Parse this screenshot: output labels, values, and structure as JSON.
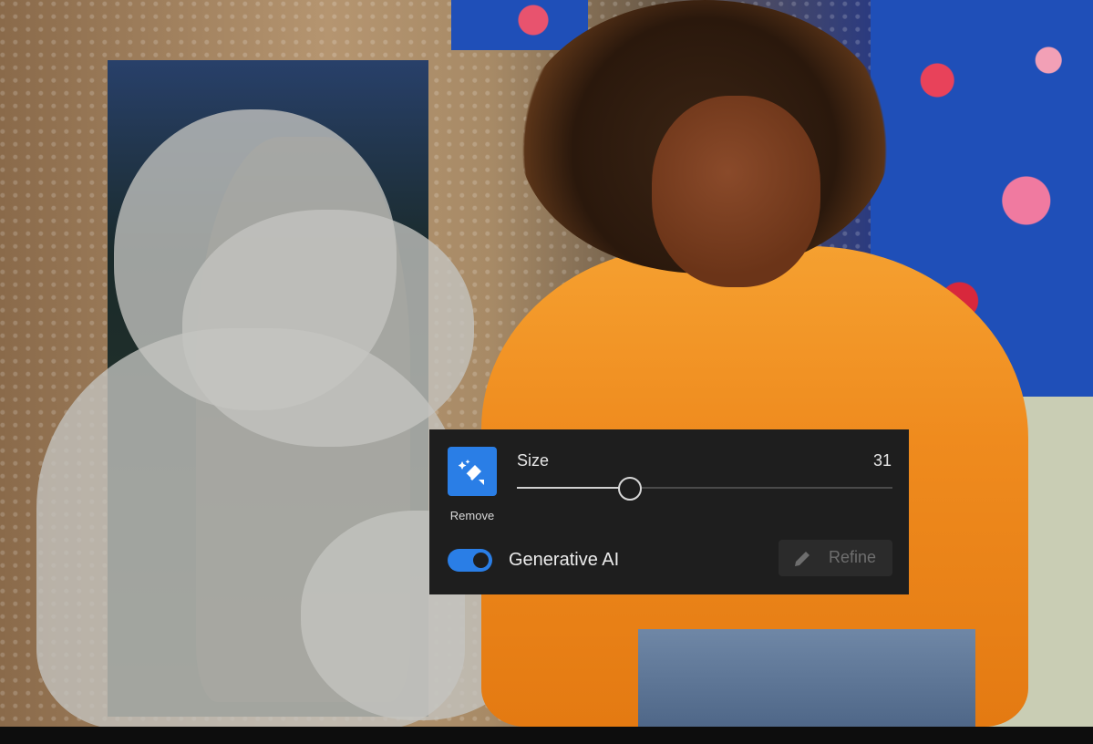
{
  "tool": {
    "label": "Remove",
    "icon": "eraser-sparkle-icon",
    "accent": "#2a7ee6"
  },
  "size": {
    "label": "Size",
    "value": "31",
    "fraction": 0.3
  },
  "generative_ai": {
    "label": "Generative AI",
    "enabled": true
  },
  "refine": {
    "label": "Refine",
    "icon": "pencil-icon",
    "disabled": true
  },
  "colors": {
    "panel": "#1e1e1e",
    "accent": "#2a7ee6",
    "jacket": "#ef8b1e"
  }
}
